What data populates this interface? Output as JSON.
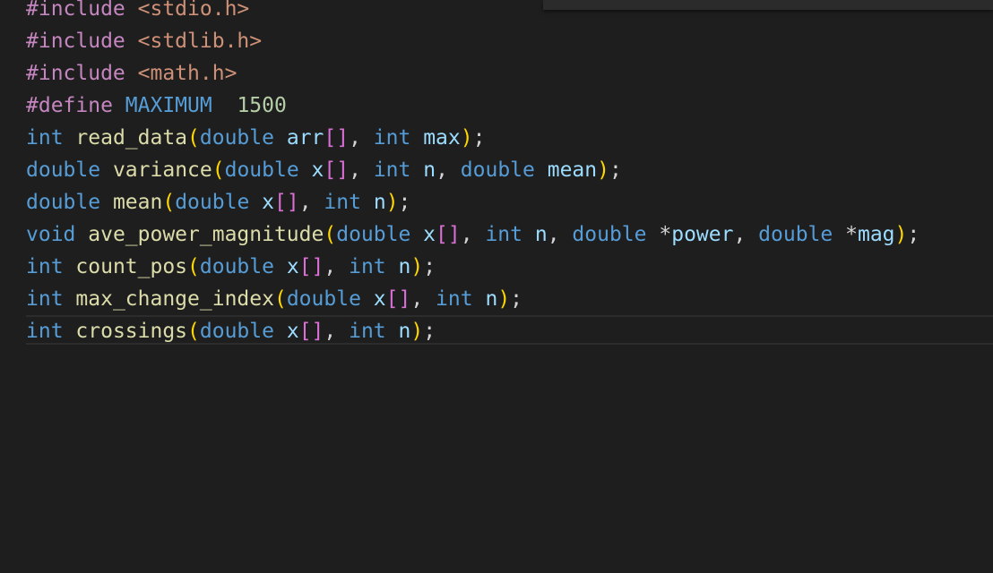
{
  "editor": {
    "lines": [
      [
        [
          "preproc",
          "#include"
        ],
        [
          "punct",
          " "
        ],
        [
          "string",
          "<stdio.h>"
        ]
      ],
      [
        [
          "preproc",
          "#include"
        ],
        [
          "punct",
          " "
        ],
        [
          "string",
          "<stdlib.h>"
        ]
      ],
      [
        [
          "preproc",
          "#include"
        ],
        [
          "punct",
          " "
        ],
        [
          "string",
          "<math.h>"
        ]
      ],
      [
        [
          "preproc",
          "#define"
        ],
        [
          "punct",
          " "
        ],
        [
          "macro",
          "MAXIMUM"
        ],
        [
          "punct",
          "  "
        ],
        [
          "number",
          "1500"
        ]
      ],
      [
        [
          "type",
          "int"
        ],
        [
          "punct",
          " "
        ],
        [
          "func",
          "read_data"
        ],
        [
          "paren",
          "("
        ],
        [
          "type",
          "double"
        ],
        [
          "punct",
          " "
        ],
        [
          "var",
          "arr"
        ],
        [
          "bracket",
          "[]"
        ],
        [
          "punct",
          ", "
        ],
        [
          "type",
          "int"
        ],
        [
          "punct",
          " "
        ],
        [
          "var",
          "max"
        ],
        [
          "paren",
          ")"
        ],
        [
          "punct",
          ";"
        ]
      ],
      [
        [
          "type",
          "double"
        ],
        [
          "punct",
          " "
        ],
        [
          "func",
          "variance"
        ],
        [
          "paren",
          "("
        ],
        [
          "type",
          "double"
        ],
        [
          "punct",
          " "
        ],
        [
          "var",
          "x"
        ],
        [
          "bracket",
          "[]"
        ],
        [
          "punct",
          ", "
        ],
        [
          "type",
          "int"
        ],
        [
          "punct",
          " "
        ],
        [
          "var",
          "n"
        ],
        [
          "punct",
          ", "
        ],
        [
          "type",
          "double"
        ],
        [
          "punct",
          " "
        ],
        [
          "var",
          "mean"
        ],
        [
          "paren",
          ")"
        ],
        [
          "punct",
          ";"
        ]
      ],
      [
        [
          "type",
          "double"
        ],
        [
          "punct",
          " "
        ],
        [
          "func",
          "mean"
        ],
        [
          "paren",
          "("
        ],
        [
          "type",
          "double"
        ],
        [
          "punct",
          " "
        ],
        [
          "var",
          "x"
        ],
        [
          "bracket",
          "[]"
        ],
        [
          "punct",
          ", "
        ],
        [
          "type",
          "int"
        ],
        [
          "punct",
          " "
        ],
        [
          "var",
          "n"
        ],
        [
          "paren",
          ")"
        ],
        [
          "punct",
          ";"
        ]
      ],
      [
        [
          "type",
          "void"
        ],
        [
          "punct",
          " "
        ],
        [
          "func",
          "ave_power_magnitude"
        ],
        [
          "paren",
          "("
        ],
        [
          "type",
          "double"
        ],
        [
          "punct",
          " "
        ],
        [
          "var",
          "x"
        ],
        [
          "bracket",
          "[]"
        ],
        [
          "punct",
          ", "
        ],
        [
          "type",
          "int"
        ],
        [
          "punct",
          " "
        ],
        [
          "var",
          "n"
        ],
        [
          "punct",
          ", "
        ],
        [
          "type",
          "double"
        ],
        [
          "punct",
          " "
        ],
        [
          "op",
          "*"
        ],
        [
          "var",
          "power"
        ],
        [
          "punct",
          ", "
        ],
        [
          "type",
          "double"
        ],
        [
          "punct",
          " "
        ],
        [
          "op",
          "*"
        ],
        [
          "var",
          "mag"
        ],
        [
          "paren",
          ")"
        ],
        [
          "punct",
          ";"
        ]
      ],
      [
        [
          "type",
          "int"
        ],
        [
          "punct",
          " "
        ],
        [
          "func",
          "count_pos"
        ],
        [
          "paren",
          "("
        ],
        [
          "type",
          "double"
        ],
        [
          "punct",
          " "
        ],
        [
          "var",
          "x"
        ],
        [
          "bracket",
          "[]"
        ],
        [
          "punct",
          ", "
        ],
        [
          "type",
          "int"
        ],
        [
          "punct",
          " "
        ],
        [
          "var",
          "n"
        ],
        [
          "paren",
          ")"
        ],
        [
          "punct",
          ";"
        ]
      ],
      [
        [
          "type",
          "int"
        ],
        [
          "punct",
          " "
        ],
        [
          "func",
          "max_change_index"
        ],
        [
          "paren",
          "("
        ],
        [
          "type",
          "double"
        ],
        [
          "punct",
          " "
        ],
        [
          "var",
          "x"
        ],
        [
          "bracket",
          "[]"
        ],
        [
          "punct",
          ", "
        ],
        [
          "type",
          "int"
        ],
        [
          "punct",
          " "
        ],
        [
          "var",
          "n"
        ],
        [
          "paren",
          ")"
        ],
        [
          "punct",
          ";"
        ]
      ],
      [
        [
          "type",
          "int"
        ],
        [
          "punct",
          " "
        ],
        [
          "func",
          "crossings"
        ],
        [
          "paren",
          "("
        ],
        [
          "type",
          "double"
        ],
        [
          "punct",
          " "
        ],
        [
          "var",
          "x"
        ],
        [
          "bracket",
          "[]"
        ],
        [
          "punct",
          ", "
        ],
        [
          "type",
          "int"
        ],
        [
          "punct",
          " "
        ],
        [
          "var",
          "n"
        ],
        [
          "paren",
          ")"
        ],
        [
          "punct",
          ";"
        ]
      ]
    ],
    "colors": {
      "background": "#1e1e1e",
      "preprocessor": "#c586c0",
      "string": "#ce9178",
      "keyword_type": "#569cd6",
      "function": "#dcdcaa",
      "variable": "#9cdcfe",
      "number": "#b5cea8",
      "bracket_paren": "#ffd700",
      "bracket_square": "#da70d6",
      "punctuation": "#d4d4d4"
    }
  }
}
